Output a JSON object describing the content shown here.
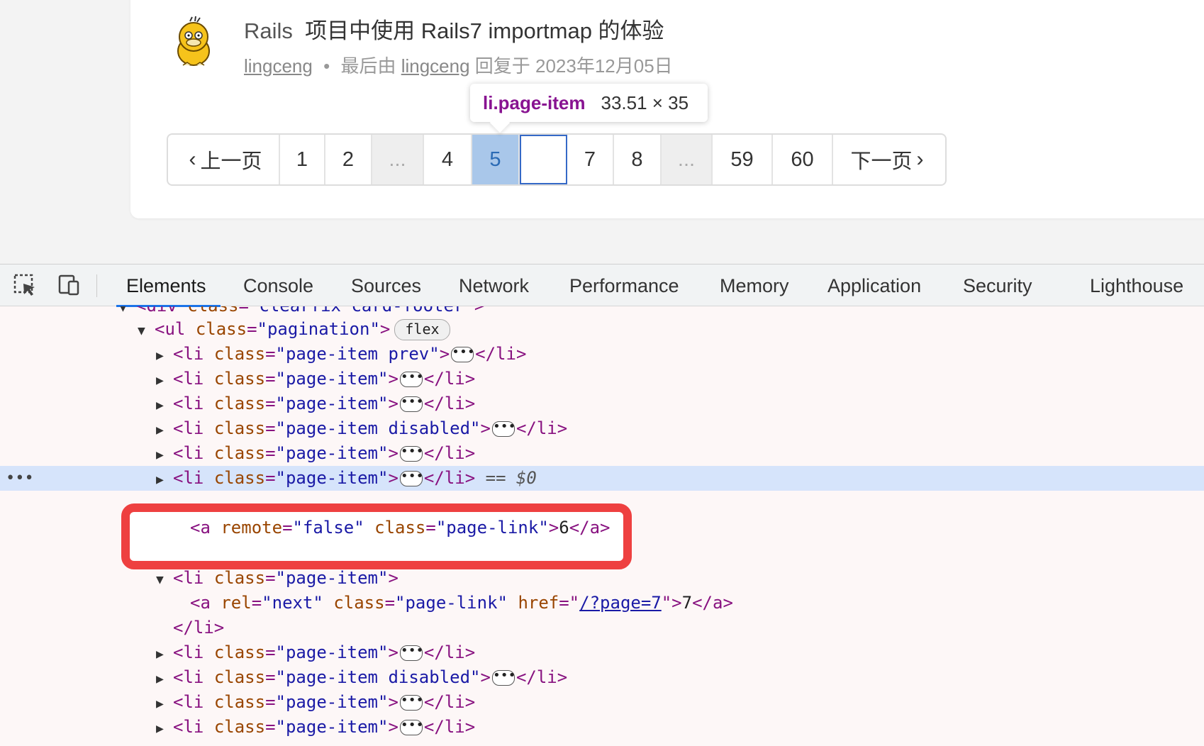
{
  "topic": {
    "title_prefix": "Rails",
    "title_main": "项目中使用 Rails7 importmap 的体验",
    "author": "lingceng",
    "separator": "•",
    "last_reply_label": "最后由",
    "last_reply_user": "lingceng",
    "reply_at_label": "回复于 2023年12月05日"
  },
  "tooltip": {
    "tag": "li.page-item",
    "dims": "33.51 × 35"
  },
  "pagination": {
    "prev": "上一页",
    "next": "下一页",
    "p1": "1",
    "p2": "2",
    "gap1": "...",
    "p4": "4",
    "p5": "5",
    "p6": "",
    "p7": "7",
    "p8": "8",
    "gap2": "...",
    "p59": "59",
    "p60": "60"
  },
  "devtools": {
    "tabs": [
      "Elements",
      "Console",
      "Sources",
      "Network",
      "Performance",
      "Memory",
      "Application",
      "Security",
      "Lighthouse"
    ],
    "active_tab": "Elements",
    "tree": {
      "l0": {
        "tag": "<div",
        "attr": "class",
        "val": "\"clearfix card-footer\"",
        "close": ">"
      },
      "l1": {
        "tag": "<ul",
        "attr": "class",
        "val": "\"pagination\"",
        "close": ">",
        "badge": "flex"
      },
      "li_prev": "\"page-item prev\"",
      "li": "\"page-item\"",
      "li_dis": "\"page-item disabled\"",
      "selected_suffix": "==",
      "dollar": "$0",
      "a6": {
        "attr1": "remote",
        "val1": "\"false\"",
        "attr2": "class",
        "val2": "\"page-link\"",
        "text": "6"
      },
      "a7": {
        "attr1": "rel",
        "val1": "\"next\"",
        "attr2": "class",
        "val2": "\"page-link\"",
        "attr3": "href",
        "href": "/?page=7",
        "text": "7"
      },
      "li_close": "</li>",
      "a_close": "</a>",
      "gutter": "•••"
    }
  }
}
